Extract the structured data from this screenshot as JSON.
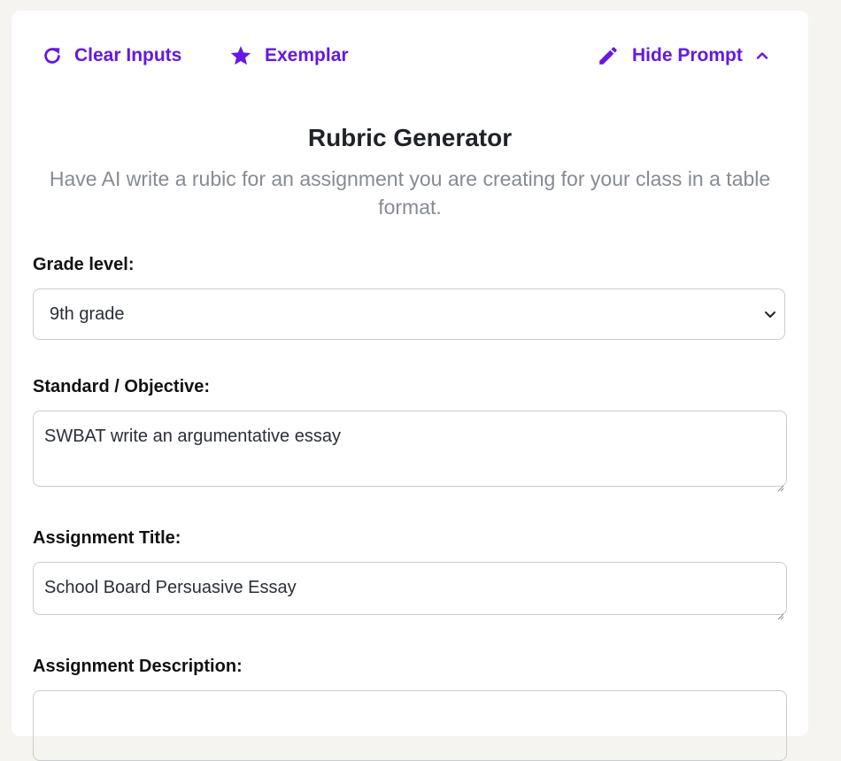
{
  "toolbar": {
    "clear_label": "Clear Inputs",
    "exemplar_label": "Exemplar",
    "hide_prompt_label": "Hide Prompt"
  },
  "tool": {
    "title": "Rubric Generator",
    "description": "Have AI write a rubic for an assignment you are creating for your class in a table format."
  },
  "form": {
    "grade_level": {
      "label": "Grade level:",
      "value": "9th grade"
    },
    "standard": {
      "label": "Standard / Objective:",
      "value": "SWBAT write an argumentative essay"
    },
    "assignment_title": {
      "label": "Assignment Title:",
      "value": "School Board Persuasive Essay"
    },
    "assignment_description": {
      "label": "Assignment Description:",
      "value": ""
    }
  },
  "colors": {
    "accent": "#6417e8",
    "page_bg": "#f5f4f0",
    "card_bg": "#ffffff",
    "subtitle": "#868b92",
    "border": "#c9ccd3"
  },
  "icons": {
    "clear": "refresh-icon",
    "exemplar": "star-icon",
    "hide_prompt": "pencil-icon",
    "collapse": "chevron-up-icon",
    "select": "chevron-down-icon"
  }
}
